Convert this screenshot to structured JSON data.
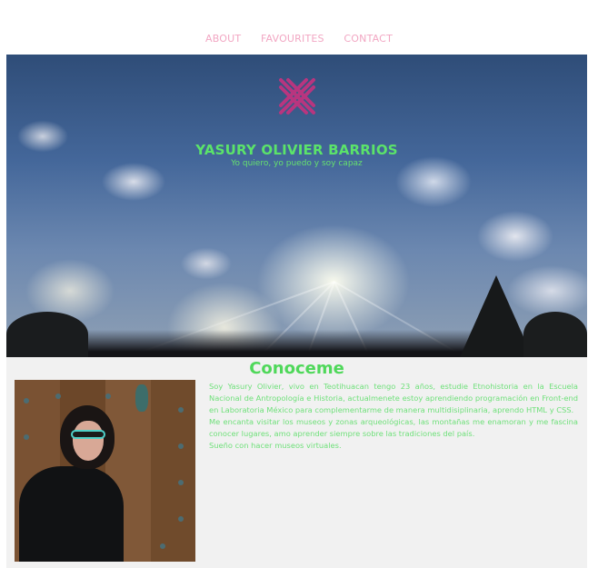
{
  "nav": {
    "items": [
      {
        "label": "ABOUT"
      },
      {
        "label": "FAVOURITES"
      },
      {
        "label": "CONTACT"
      }
    ]
  },
  "hero": {
    "title": "YASURY OLIVIER BARRIOS",
    "tagline": "Yo quiero, yo puedo y soy capaz",
    "logo_icon": "cross-stitch-logo-icon"
  },
  "about": {
    "title": "Conoceme",
    "paragraphs": [
      "Soy Yasury Olivier, vivo en Teotihuacan tengo 23 años, estudie Etnohistoria en la Escuela Nacional de Antropología e Historia, actualmenete estoy aprendiendo programación en Front-end en Laboratoria México para complementarme de manera multidisiplinaria, aprendo HTML y CSS.",
      "Me encanta visitar los museos y zonas arqueológicas, las montañas me enamoran y me fascina conocer lugares, amo aprender siempre sobre las tradiciones del país.",
      "Sueño con hacer museos virtuales."
    ]
  },
  "colors": {
    "nav": "#f2a7c3",
    "accent_green": "#5be36a",
    "logo": "#b8357f"
  }
}
